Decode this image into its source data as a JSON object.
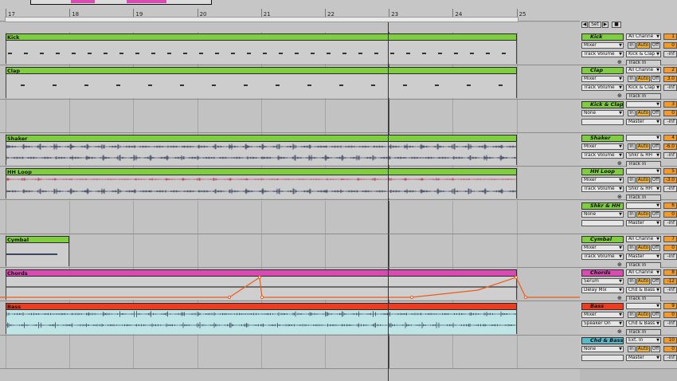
{
  "ruler": {
    "bars": [
      "17",
      "18",
      "19",
      "20",
      "21",
      "22",
      "23",
      "24",
      "25"
    ]
  },
  "locators": {
    "set_label": "Set"
  },
  "tracks": [
    {
      "name": "Kick",
      "clip": "Kick",
      "color": "#7fce40",
      "clip_kind": "midi-hits",
      "input": "All Channe",
      "route_a": "Mixer",
      "route_b": "Track Volume",
      "output": "Kick & Clap",
      "monitor_in": "In",
      "monitor_auto": "Auto",
      "monitor_off": "Off",
      "track_in": "Track In",
      "number": "1",
      "value": "0",
      "volume": "-inf"
    },
    {
      "name": "Clap",
      "clip": "Clap",
      "color": "#7fce40",
      "clip_kind": "midi-hits-sparse",
      "input": "All Channe",
      "route_a": "Mixer",
      "route_b": "Track Volume",
      "output": "Kick & Clap",
      "monitor_in": "In",
      "monitor_auto": "Auto",
      "monitor_off": "Off",
      "track_in": "Track In",
      "number": "2",
      "value": "3.0",
      "volume": "-inf"
    },
    {
      "name": "Kick & Clap",
      "clip": "",
      "color": "#7fce40",
      "clip_kind": "none",
      "input": "",
      "route_a": "None",
      "route_b": "",
      "output": "Master",
      "monitor_in": "In",
      "monitor_auto": "Auto",
      "monitor_off": "Off",
      "track_in": "",
      "number": "3",
      "value": "0",
      "volume": "-inf"
    },
    {
      "name": "Shaker",
      "clip": "Shaker",
      "color": "#7fce40",
      "clip_kind": "audio-dense",
      "input": "",
      "route_a": "Mixer",
      "route_b": "Track Volume",
      "output": "Shkr & HH",
      "monitor_in": "In",
      "monitor_auto": "Auto",
      "monitor_off": "Off",
      "track_in": "Track In",
      "number": "4",
      "value": "-6.0",
      "volume": "-inf"
    },
    {
      "name": "HH Loop",
      "clip": "HH Loop",
      "color": "#7fce40",
      "clip_kind": "audio-hh",
      "input": "",
      "route_a": "Mixer",
      "route_b": "Track Volume",
      "output": "Shkr & HH",
      "monitor_in": "In",
      "monitor_auto": "Auto",
      "monitor_off": "Off",
      "track_in": "Track In",
      "number": "5",
      "value": "-3.0",
      "volume": "-inf"
    },
    {
      "name": "Shkr & HH",
      "clip": "",
      "color": "#7fce40",
      "clip_kind": "none",
      "input": "",
      "route_a": "None",
      "route_b": "",
      "output": "Master",
      "monitor_in": "In",
      "monitor_auto": "Auto",
      "monitor_off": "Off",
      "track_in": "",
      "number": "6",
      "value": "0",
      "volume": "-inf"
    },
    {
      "name": "Cymbal",
      "clip": "Cymbal",
      "color": "#7fce40",
      "clip_kind": "cymbal",
      "input": "All Channe",
      "route_a": "Mixer",
      "route_b": "Track Volume",
      "output": "Master",
      "monitor_in": "In",
      "monitor_auto": "Auto",
      "monitor_off": "Off",
      "track_in": "Track In",
      "number": "7",
      "value": "0",
      "volume": "-inf"
    },
    {
      "name": "Chords",
      "clip": "Chords",
      "color": "#d94ab3",
      "clip_kind": "automation",
      "input": "All Channe",
      "route_a": "Serum",
      "route_b": "Delay Mix",
      "output": "Chd & Bass",
      "monitor_in": "In",
      "monitor_auto": "Auto",
      "monitor_off": "Off",
      "track_in": "Track In",
      "number": "8",
      "value": "-12",
      "volume": "-inf"
    },
    {
      "name": "Bass",
      "clip": "Bass",
      "color": "#ef3c1f",
      "clip_kind": "audio-bass",
      "input": "",
      "route_a": "Mixer",
      "route_b": "Speaker On",
      "output": "Chd & Bass",
      "monitor_in": "In",
      "monitor_auto": "Auto",
      "monitor_off": "Off",
      "track_in": "Track In",
      "number": "9",
      "value": "0",
      "volume": "-inf"
    },
    {
      "name": "Chd & Bass",
      "clip": "",
      "color": "#58b9c9",
      "clip_kind": "none",
      "input": "Ext. In",
      "route_a": "None",
      "route_b": "",
      "output": "Master",
      "monitor_in": "In",
      "monitor_auto": "Auto",
      "monitor_off": "Off",
      "track_in": "",
      "number": "10",
      "value": "0",
      "volume": "-inf"
    }
  ]
}
